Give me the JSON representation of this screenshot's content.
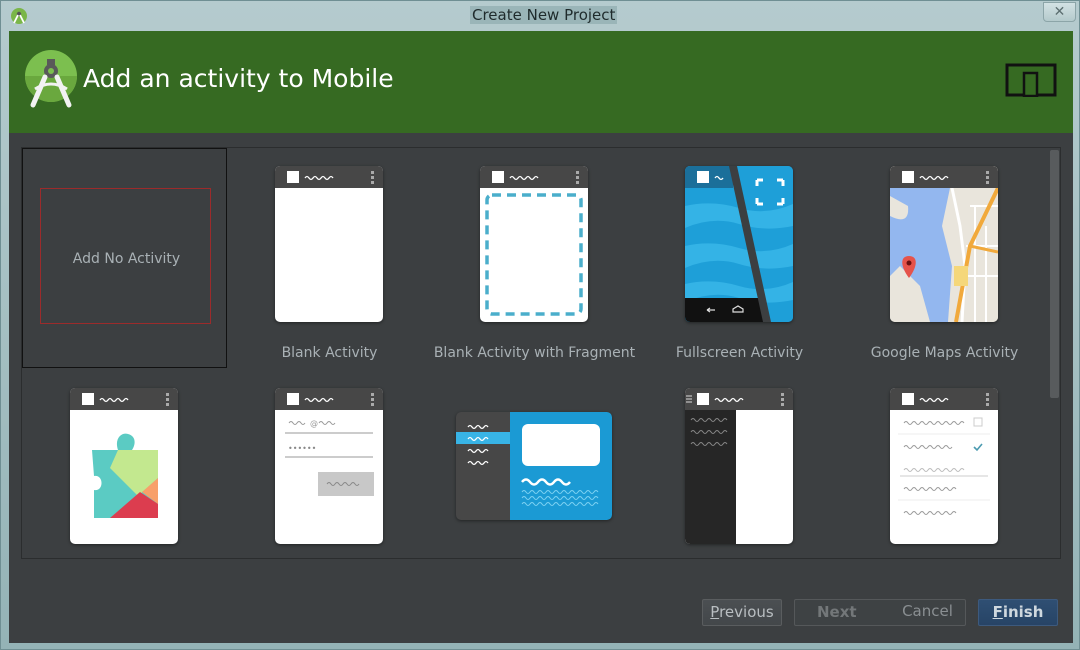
{
  "window": {
    "title": "Create New Project",
    "close_glyph": "✕"
  },
  "header": {
    "title": "Add an activity to Mobile",
    "logo_icon": "android-studio-logo-icon",
    "form_factor_icon": "mobile-tablet-icon",
    "accent_color": "#366a22"
  },
  "gallery": {
    "tiles": [
      {
        "label": "Add No Activity",
        "selected": true
      },
      {
        "label": "Blank Activity",
        "thumbnail": "blank-activity"
      },
      {
        "label": "Blank Activity with Fragment",
        "thumbnail": "blank-fragment"
      },
      {
        "label": "Fullscreen Activity",
        "thumbnail": "fullscreen"
      },
      {
        "label": "Google Maps Activity",
        "thumbnail": "google-maps"
      },
      {
        "label": "",
        "thumbnail": "google-play-services"
      },
      {
        "label": "",
        "thumbnail": "login"
      },
      {
        "label": "",
        "thumbnail": "master-detail"
      },
      {
        "label": "",
        "thumbnail": "navigation-drawer"
      },
      {
        "label": "",
        "thumbnail": "settings"
      }
    ]
  },
  "footer": {
    "previous": {
      "mnemonic": "P",
      "rest": "revious"
    },
    "next": "Next",
    "cancel": "Cancel",
    "finish": {
      "mnemonic": "F",
      "rest": "inish"
    }
  }
}
